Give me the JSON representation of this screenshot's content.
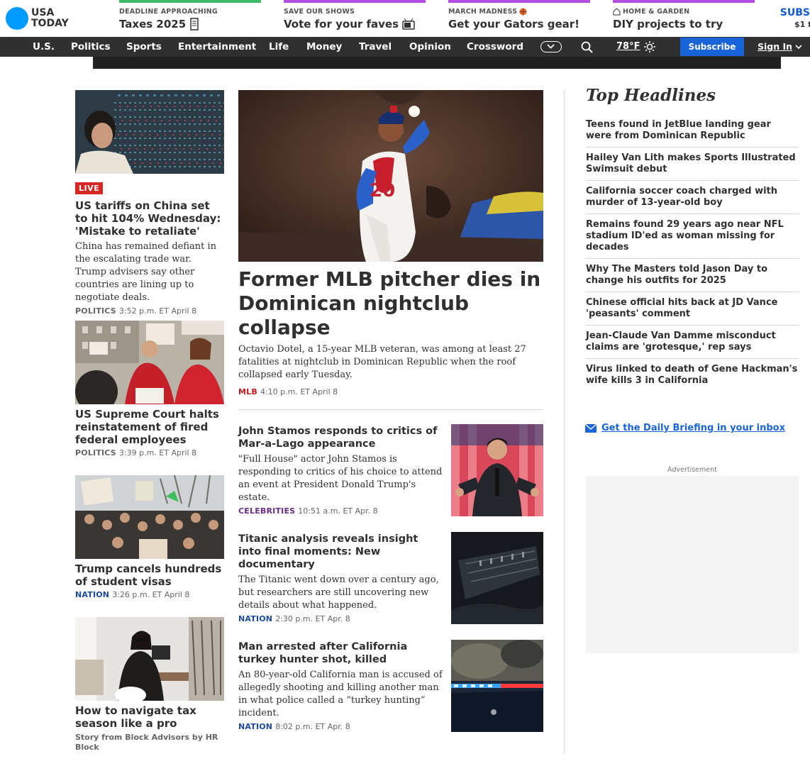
{
  "logo": {
    "line1": "USA",
    "line2": "TODAY"
  },
  "promos": [
    {
      "kicker": "DEADLINE APPROACHING",
      "title": "Taxes 2025",
      "color": "#3fba6b",
      "icon": "receipt-icon"
    },
    {
      "kicker": "SAVE OUR SHOWS",
      "title": "Vote for your faves",
      "color": "#b44fe0",
      "icon": "tv-icon"
    },
    {
      "kicker": "MARCH MADNESS",
      "title": "Get your Gators gear!",
      "color": "#b44fe0",
      "icon": "basketball-icon"
    },
    {
      "kicker": "HOME & GARDEN",
      "title": "DIY projects to try",
      "color": "#b44fe0",
      "icon": "house-icon"
    }
  ],
  "subscribe_corner": {
    "label": "SUBS",
    "price": "$1 f"
  },
  "nav": {
    "items": [
      "U.S.",
      "Politics",
      "Sports",
      "Entertainment",
      "Life",
      "Money",
      "Travel",
      "Opinion",
      "Crossword"
    ],
    "temperature": "78°F",
    "subscribe": "Subscribe",
    "signin": "Sign In"
  },
  "left_stories": [
    {
      "badge": "LIVE",
      "headline": "US tariffs on China set to hit 104% Wednesday: 'Mistake to retaliate'",
      "dek": "China has remained defiant in the escalating trade war. Trump advisers say other countries are lining up to negotiate deals.",
      "section": "POLITICS",
      "time": "3:52 p.m. ET April 8"
    },
    {
      "headline": "US Supreme Court halts reinstatement of fired federal employees",
      "section": "POLITICS",
      "time": "3:39 p.m. ET April 8"
    },
    {
      "headline": "Trump cancels hundreds of student visas",
      "section": "NATION",
      "time": "3:26 p.m. ET April 8"
    },
    {
      "headline": "How to navigate tax season like a pro",
      "sponsor": "Story from Block Advisors by HR Block"
    }
  ],
  "hero": {
    "headline": "Former MLB pitcher dies in Dominican nightclub collapse",
    "dek": "Octavio Dotel, a 15-year MLB veteran, was among at least 27 fatalities at nightclub in Dominican Republic when the roof collapsed early Tuesday.",
    "section": "MLB",
    "time": "4:10 p.m. ET April 8"
  },
  "center_stories": [
    {
      "headline": "John Stamos responds to critics of Mar-a-Lago appearance",
      "dek": "\"Full House\" actor John Stamos is responding to critics of his choice to attend an event at President Donald Trump's estate.",
      "section": "CELEBRITIES",
      "time": "10:51 a.m. ET Apr. 8"
    },
    {
      "headline": "Titanic analysis reveals insight into final moments: New documentary",
      "dek": "The Titanic went down over a century ago, but researchers are still uncovering new details about what happened.",
      "section": "NATION",
      "time": "2:30 p.m. ET Apr. 8"
    },
    {
      "headline": "Man arrested after California turkey hunter shot, killed",
      "dek": "An 80-year-old California man is accused of allegedly shooting and killing another man in what police called a “turkey hunting” incident.",
      "section": "NATION",
      "time": "8:02 p.m. ET Apr. 8"
    }
  ],
  "top_headlines": {
    "title": "Top Headlines",
    "items": [
      "Teens found in JetBlue landing gear were from Dominican Republic",
      "Hailey Van Lith makes Sports Illustrated Swimsuit debut",
      "California soccer coach charged with murder of 13-year-old boy",
      "Remains found 29 years ago near NFL stadium ID'ed as woman missing for decades",
      "Why The Masters told Jason Day to change his outfits for 2025",
      "Chinese official hits back at JD Vance 'peasants' comment",
      "Jean-Claude Van Damme misconduct claims are 'grotesque,' rep says",
      "Virus linked to death of Gene Hackman's wife kills 3 in California"
    ]
  },
  "briefing": "Get the Daily Briefing in your inbox",
  "ad_label": "Advertisement",
  "section_colors": {
    "POLITICS": "#666666",
    "NATION": "#1a4b9c",
    "MLB": "#c2191d",
    "CELEBRITIES": "#6b2d8a"
  }
}
